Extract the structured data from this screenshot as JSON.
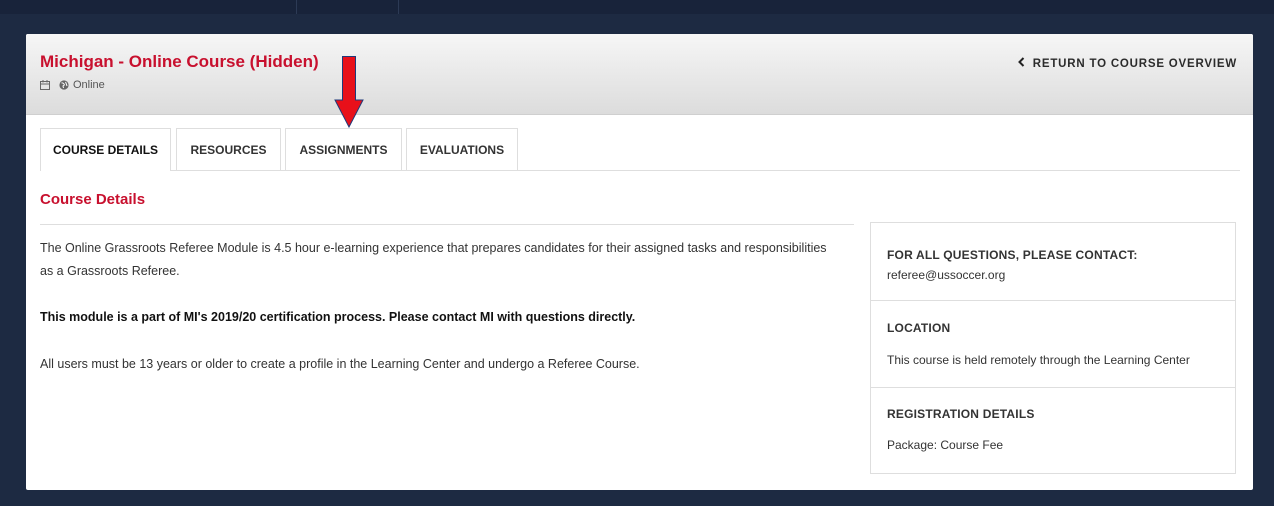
{
  "course": {
    "title": "Michigan - Online Course (Hidden)",
    "mode": "Online"
  },
  "return_link": "RETURN TO COURSE OVERVIEW",
  "tabs": [
    {
      "label": "COURSE DETAILS",
      "active": true
    },
    {
      "label": "RESOURCES",
      "active": false
    },
    {
      "label": "ASSIGNMENTS",
      "active": false
    },
    {
      "label": "EVALUATIONS",
      "active": false
    }
  ],
  "details": {
    "heading": "Course Details",
    "paragraph1": "The Online Grassroots Referee Module is 4.5 hour e-learning experience that prepares candidates for their assigned tasks and responsibilities as a Grassroots Referee.",
    "paragraph2": "This module is a part of MI's 2019/20 certification process. Please contact MI with questions directly.",
    "paragraph3": "All users must be 13 years or older to create a profile in the Learning Center and undergo a Referee Course."
  },
  "sidebar": {
    "contact_heading": "FOR ALL QUESTIONS, PLEASE CONTACT:",
    "contact_email": "referee@ussoccer.org",
    "location_heading": "LOCATION",
    "location_text": "This course is held remotely through the Learning Center",
    "registration_heading": "REGISTRATION DETAILS",
    "registration_text": "Package: Course Fee"
  },
  "colors": {
    "brand_red": "#c8102e",
    "link_blue": "#1a7ad6",
    "annotation_arrow": "#e8101a",
    "page_background": "#1d2a42"
  },
  "icons": [
    "calendar-icon",
    "globe-icon",
    "chevron-left-icon",
    "down-arrow-annotation"
  ]
}
